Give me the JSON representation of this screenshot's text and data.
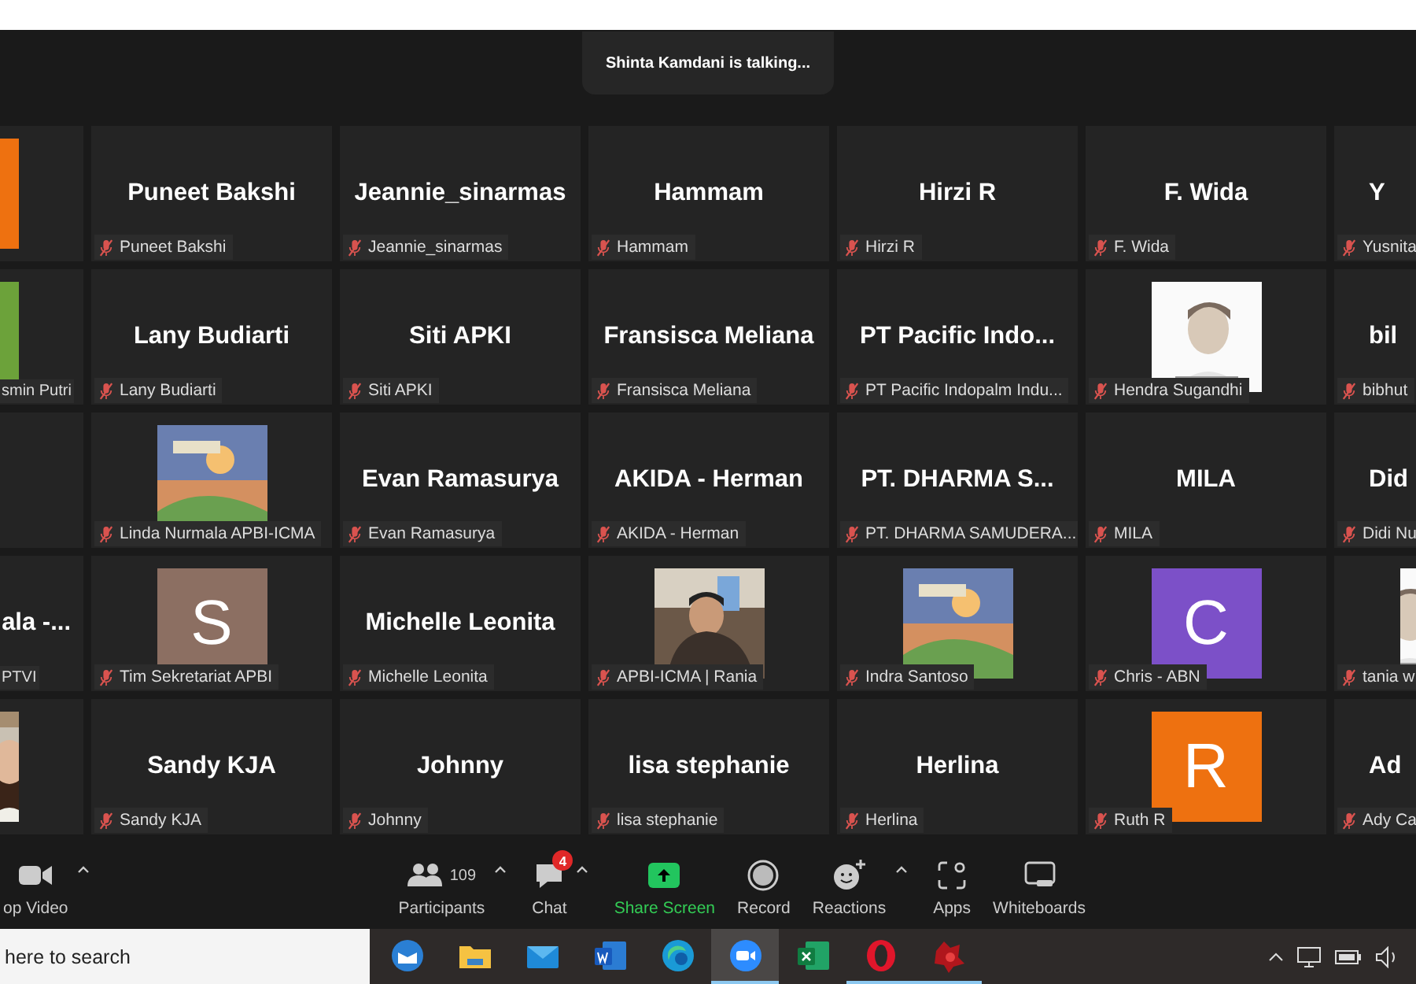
{
  "banner": "Shinta Kamdani is talking...",
  "tiles": [
    {
      "kind": "avatar",
      "color": "#ee7110"
    },
    {
      "kind": "name",
      "name": "Puneet Bakshi",
      "label": "Puneet Bakshi",
      "muted": true
    },
    {
      "kind": "name",
      "name": "Jeannie_sinarmas",
      "label": "Jeannie_sinarmas",
      "muted": true
    },
    {
      "kind": "name",
      "name": "Hammam",
      "label": "Hammam",
      "muted": true
    },
    {
      "kind": "name",
      "name": "Hirzi R",
      "label": "Hirzi R",
      "muted": true
    },
    {
      "kind": "name",
      "name": "F. Wida",
      "label": "F. Wida",
      "muted": true
    },
    {
      "kind": "name",
      "name": "Y",
      "label": "Yusnita",
      "muted": true
    },
    {
      "kind": "avatar",
      "color": "#6ca23a",
      "label": "smin Putri"
    },
    {
      "kind": "name",
      "name": "Lany Budiarti",
      "label": "Lany Budiarti",
      "muted": true
    },
    {
      "kind": "name",
      "name": "Siti APKI",
      "label": "Siti APKI",
      "muted": true
    },
    {
      "kind": "name",
      "name": "Fransisca Meliana",
      "label": "Fransisca Meliana",
      "muted": true
    },
    {
      "kind": "name",
      "name": "PT Pacific Indo...",
      "label": "PT Pacific Indopalm Indu...",
      "muted": true
    },
    {
      "kind": "picture",
      "label": "Hendra Sugandhi",
      "muted": true
    },
    {
      "kind": "name",
      "name": "bil",
      "label": "bibhut",
      "muted": true
    },
    {
      "kind": "empty"
    },
    {
      "kind": "picture",
      "label": "Linda Nurmala APBI-ICMA",
      "muted": true
    },
    {
      "kind": "name",
      "name": "Evan Ramasurya",
      "label": "Evan Ramasurya",
      "muted": true
    },
    {
      "kind": "name",
      "name": "AKIDA - Herman",
      "label": "AKIDA - Herman",
      "muted": true
    },
    {
      "kind": "name",
      "name": "PT. DHARMA S...",
      "label": "PT. DHARMA SAMUDERA...",
      "muted": true
    },
    {
      "kind": "name",
      "name": "MILA",
      "label": "MILA",
      "muted": true
    },
    {
      "kind": "name",
      "name": "Did",
      "label": "Didi Nu",
      "muted": true
    },
    {
      "kind": "name",
      "name": "ala -...",
      "label": "PTVI"
    },
    {
      "kind": "avatar",
      "letter": "S",
      "color": "#8c6f62",
      "label": "Tim Sekretariat APBI",
      "muted": true
    },
    {
      "kind": "name",
      "name": "Michelle Leonita",
      "label": "Michelle Leonita",
      "muted": true
    },
    {
      "kind": "picture",
      "label": "APBI-ICMA | Rania",
      "muted": true
    },
    {
      "kind": "picture",
      "label": "Indra Santoso",
      "muted": true
    },
    {
      "kind": "avatar",
      "letter": "C",
      "color": "#7c50c8",
      "label": "Chris - ABN",
      "muted": true
    },
    {
      "kind": "picture",
      "label": "tania w",
      "muted": true
    },
    {
      "kind": "picture"
    },
    {
      "kind": "name",
      "name": "Sandy KJA",
      "label": "Sandy KJA",
      "muted": true
    },
    {
      "kind": "name",
      "name": "Johnny",
      "label": "Johnny",
      "muted": true
    },
    {
      "kind": "name",
      "name": "lisa stephanie",
      "label": "lisa stephanie",
      "muted": true
    },
    {
      "kind": "name",
      "name": "Herlina",
      "label": "Herlina",
      "muted": true
    },
    {
      "kind": "avatar",
      "letter": "R",
      "color": "#ee7110",
      "label": "Ruth R",
      "muted": true
    },
    {
      "kind": "name",
      "name": "Ad",
      "label": "Ady Ca",
      "muted": true
    }
  ],
  "toolbar": [
    {
      "kind": "video",
      "label": "op Video",
      "menu": true
    },
    {
      "kind": "participants",
      "label": "Participants",
      "count": "109",
      "menu": true
    },
    {
      "kind": "chat",
      "label": "Chat",
      "badge": "4",
      "menu": true
    },
    {
      "kind": "share",
      "label": "Share Screen",
      "menu": false
    },
    {
      "kind": "record",
      "label": "Record",
      "menu": false
    },
    {
      "kind": "reactions",
      "label": "Reactions",
      "menu": true
    },
    {
      "kind": "apps",
      "label": "Apps",
      "menu": false
    },
    {
      "kind": "whiteboards",
      "label": "Whiteboards",
      "menu": false
    }
  ],
  "taskbar": {
    "search": {
      "placeholder": "here to search"
    },
    "apps": [
      {
        "kind": "outlook",
        "selected": false,
        "running": false
      },
      {
        "kind": "folder",
        "selected": false,
        "running": false
      },
      {
        "kind": "mail",
        "selected": false,
        "running": false
      },
      {
        "kind": "word",
        "selected": false,
        "running": false
      },
      {
        "kind": "edge",
        "selected": false,
        "running": false
      },
      {
        "kind": "zoom",
        "selected": true,
        "running": true
      },
      {
        "kind": "excel",
        "selected": false,
        "running": false
      },
      {
        "kind": "opera",
        "selected": false,
        "running": true
      },
      {
        "kind": "game",
        "selected": false,
        "running": true
      }
    ]
  }
}
